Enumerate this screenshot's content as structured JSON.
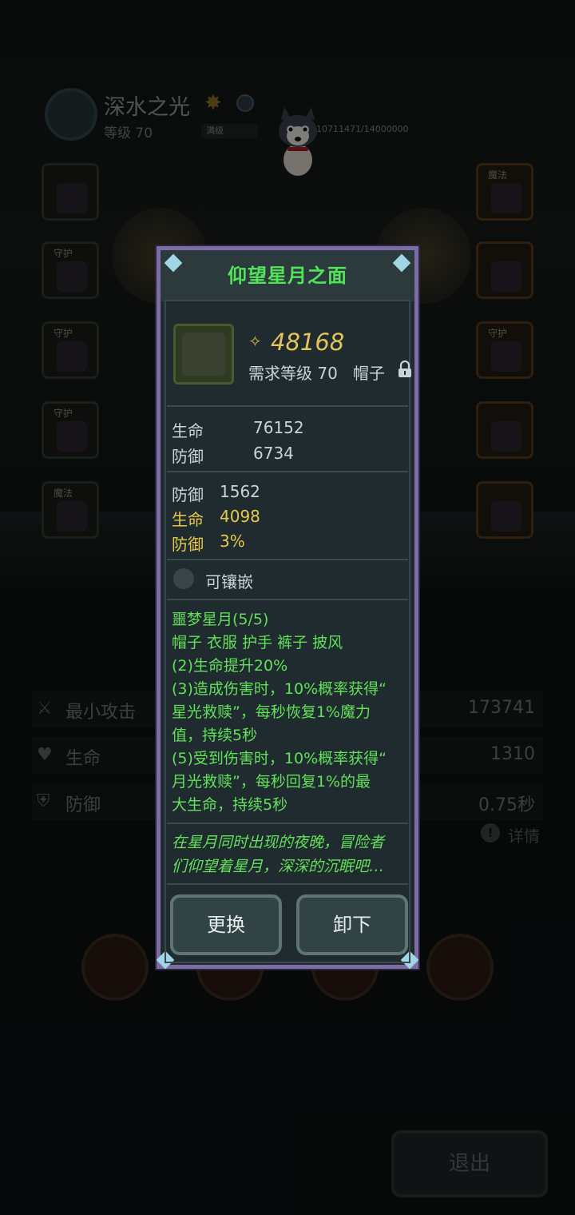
{
  "header": {
    "title": "深水之光",
    "level": "等级 70",
    "xp_bar_label": "满级",
    "xp_text": "10711471/14000000"
  },
  "equipment_left": [
    {
      "tag": "",
      "icon": "helmet-icon"
    },
    {
      "tag": "守护",
      "icon": "armor-icon"
    },
    {
      "tag": "守护",
      "icon": "boots-icon"
    },
    {
      "tag": "守护",
      "icon": "glove-icon"
    },
    {
      "tag": "魔法",
      "icon": "cape-icon"
    }
  ],
  "equipment_right": [
    {
      "tag": "魔法",
      "icon": "sword-icon"
    },
    {
      "tag": "",
      "icon": "ring-icon"
    },
    {
      "tag": "守护",
      "icon": "necklace-icon"
    },
    {
      "tag": "",
      "icon": "amulet-icon"
    },
    {
      "tag": "",
      "icon": "relic-icon"
    }
  ],
  "stats": [
    {
      "label": "最小攻击",
      "value": "173741",
      "icon": "attack-icon"
    },
    {
      "label": "生命",
      "value": "1310",
      "icon": "heart-icon"
    },
    {
      "label": "防御",
      "value": "0.75秒",
      "icon": "shield-icon"
    }
  ],
  "detail_label": "详情",
  "exit_label": "退出",
  "popup": {
    "title": "仰望星月之面",
    "power": "48168",
    "requirement": "需求等级 70",
    "slot_type": "帽子",
    "base_stats": [
      {
        "label": "生命",
        "value": "76152"
      },
      {
        "label": "防御",
        "value": "6734"
      }
    ],
    "extra_stats": [
      {
        "label": "防御",
        "value": "1562",
        "color": "#c8d4d6"
      },
      {
        "label": "生命",
        "value": "4098",
        "color": "#e8c84a"
      },
      {
        "label": "防御",
        "value": "3%",
        "color": "#e8c84a"
      }
    ],
    "socket_label": "可镶嵌",
    "set_lines": [
      "噩梦星月(5/5)",
      "帽子 衣服 护手 裤子 披风",
      "(2)生命提升20%",
      "(3)造成伤害时，10%概率获得“",
      "星光救赎”，每秒恢复1%魔力",
      "值，持续5秒",
      "(5)受到伤害时，10%概率获得“",
      "月光救赎”，每秒回复1%的最",
      "大生命，持续5秒"
    ],
    "lore_lines": [
      "在星月同时出现的夜晚，冒险者",
      "们仰望着星月，深深的沉眠吧…"
    ],
    "replace_label": "更换",
    "unequip_label": "卸下"
  }
}
